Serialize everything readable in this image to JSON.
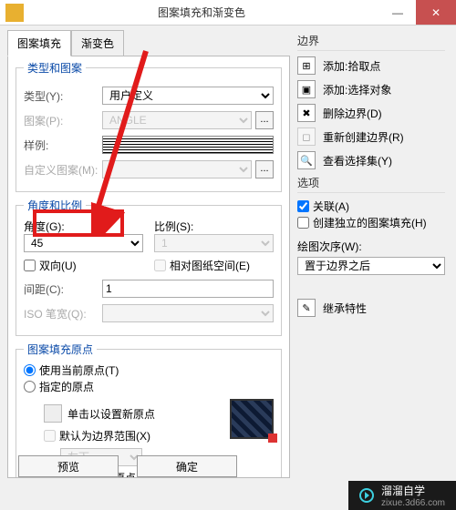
{
  "title": "图案填充和渐变色",
  "tabs": {
    "fill": "图案填充",
    "grad": "渐变色"
  },
  "typeGroup": {
    "legend": "类型和图案",
    "type_label": "类型(Y):",
    "type_value": "用户定义",
    "pattern_label": "图案(P):",
    "pattern_value": "ANGLE",
    "sample_label": "样例:",
    "custom_label": "自定义图案(M):"
  },
  "angleGroup": {
    "legend": "角度和比例",
    "angle_label": "角度(G):",
    "angle_value": "45",
    "scale_label": "比例(S):",
    "scale_value": "1",
    "bidir": "双向(U)",
    "paperspace": "相对图纸空间(E)",
    "spacing_label": "间距(C):",
    "spacing_value": "1",
    "iso_label": "ISO 笔宽(Q):"
  },
  "originGroup": {
    "legend": "图案填充原点",
    "use_current": "使用当前原点(T)",
    "specified": "指定的原点",
    "click_set": "单击以设置新原点",
    "default_bound": "默认为边界范围(X)",
    "pos_value": "左下",
    "store_default": "存储为默认原点(F)"
  },
  "boundary": {
    "title": "边界",
    "add_pick": "添加:拾取点",
    "add_select": "添加:选择对象",
    "del": "删除边界(D)",
    "recreate": "重新创建边界(R)",
    "view_sel": "查看选择集(Y)"
  },
  "options": {
    "title": "选项",
    "assoc": "关联(A)",
    "independent": "创建独立的图案填充(H)",
    "draw_order": "绘图次序(W):",
    "draw_order_value": "置于边界之后"
  },
  "inherit": "继承特性",
  "footer": {
    "preview": "预览",
    "ok": "确定"
  },
  "brand": {
    "name": "溜溜自学",
    "url": "zixue.3d66.com"
  }
}
